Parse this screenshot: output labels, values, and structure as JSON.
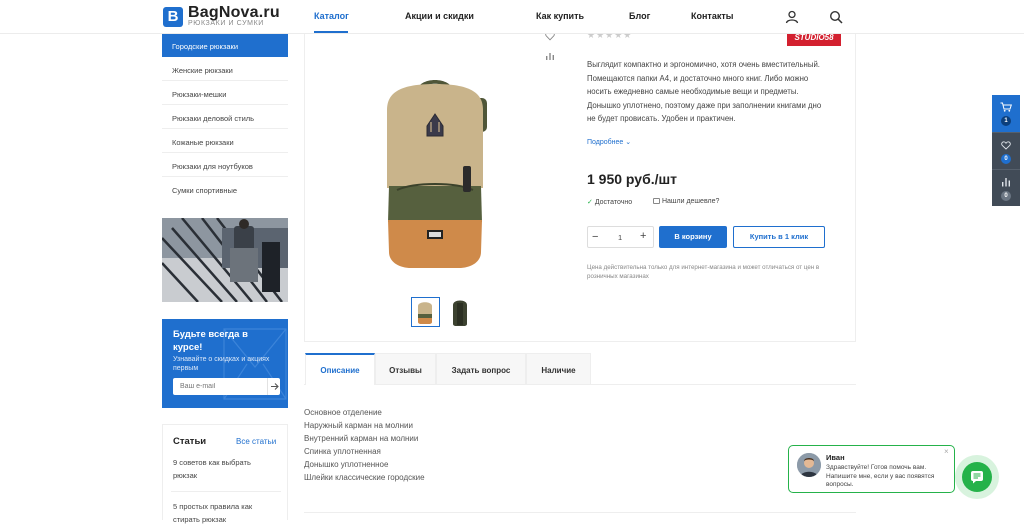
{
  "colors": {
    "accent": "#1f6fce",
    "chat_green": "#25b24a",
    "price_text": "#222",
    "stock_green": "#25b24a",
    "brand_red": "#d3202f"
  },
  "header": {
    "logo_letter": "B",
    "logo_name": "BagNova.ru",
    "logo_sub": "РЮКЗАКИ И СУМКИ",
    "nav": [
      "Каталог",
      "Акции и скидки",
      "Как купить",
      "Блог",
      "Контакты"
    ],
    "active_nav": "Каталог",
    "icons": [
      "user-icon",
      "search-icon"
    ]
  },
  "sidebar": {
    "items": [
      "Городские рюкзаки",
      "Женские рюкзаки",
      "Рюкзаки-мешки",
      "Рюкзаки деловой стиль",
      "Кожаные рюкзаки",
      "Рюкзаки для ноутбуков",
      "Сумки спортивные"
    ],
    "active_index": 0
  },
  "subscribe": {
    "title": "Будьте всегда в курсе!",
    "text": "Узнавайте о скидках и акциях первым",
    "placeholder": "Ваш e-mail"
  },
  "articles": {
    "title": "Статьи",
    "all_link": "Все статьи",
    "items": [
      "9 советов как выбрать рюкзак",
      "5 простых правила как стирать рюкзак"
    ]
  },
  "product": {
    "brand_logo": "STUDIO58",
    "rating_stars": 0,
    "description": "Выглядит компактно и эргономично, хотя очень вместительный. Помещаются папки А4, и достаточно много книг. Либо можно носить ежедневно самые необходимые вещи и предметы. Донышко уплотнено, поэтому даже при заполнении книгами дно не будет провисать. Удобен и практичен.",
    "more_link": "Подробнее",
    "price": "1 950 руб./шт",
    "in_stock": "Достаточно",
    "cheaper": "Нашли дешевле?",
    "quantity": "1",
    "add_to_cart": "В корзину",
    "one_click": "Купить в 1 клик",
    "note": "Цена действительна только для интернет-магазина и может отличаться от цен в розничных магазинах"
  },
  "tabs": [
    "Описание",
    "Отзывы",
    "Задать вопрос",
    "Наличие"
  ],
  "active_tab": "Описание",
  "specs": [
    "Основное отделение",
    "Наружный карман на молнии",
    "Внутренний карман на молнии",
    "Спинка уплотненная",
    "Донышко уплотненное",
    "Шлейки классические городские"
  ],
  "right_panel": {
    "cart_count": "1",
    "wishlist_count": "0",
    "compare_count": "0"
  },
  "chat": {
    "name": "Иван",
    "message": "Здравствуйте! Готов помочь вам. Напишите мне, если у вас появятся вопросы."
  }
}
